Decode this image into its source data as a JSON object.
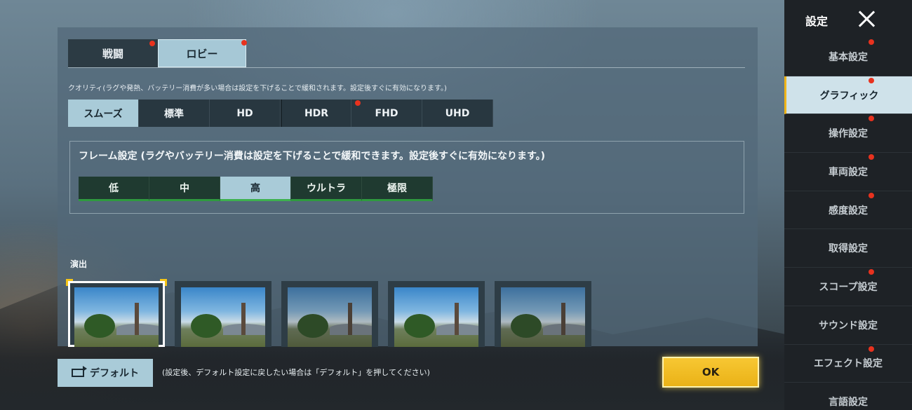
{
  "top_tabs": [
    {
      "label": "戦闘"
    },
    {
      "label": "ロビー"
    }
  ],
  "quality": {
    "note": "クオリティ(ラグや発熱、バッテリー消費が多い場合は設定を下げることで緩和されます。設定後すぐに有効になります。)",
    "options": [
      "スムーズ",
      "標準",
      "HD",
      "HDR",
      "FHD",
      "UHD"
    ],
    "selected": "スムーズ"
  },
  "frame": {
    "title": "フレーム設定 (ラグやバッテリー消費は設定を下げることで緩和できます。設定後すぐに有効になります。)",
    "options": [
      "低",
      "中",
      "高",
      "ウルトラ",
      "極限"
    ],
    "selected": "高"
  },
  "effects": {
    "label": "演出",
    "thumbnails": [
      "effect-style-1",
      "effect-style-2",
      "effect-style-3",
      "effect-style-4",
      "effect-style-5"
    ],
    "selected_index": 0
  },
  "footer": {
    "default_label": "デフォルト",
    "default_note": "(設定後、デフォルト設定に戻したい場合は「デフォルト」を押してください)",
    "ok_label": "OK"
  },
  "sidebar": {
    "title": "設定",
    "items": [
      {
        "label": "基本設定"
      },
      {
        "label": "グラフィック"
      },
      {
        "label": "操作設定"
      },
      {
        "label": "車両設定"
      },
      {
        "label": "感度設定"
      },
      {
        "label": "取得設定"
      },
      {
        "label": "スコープ設定"
      },
      {
        "label": "サウンド設定"
      },
      {
        "label": "エフェクト設定"
      },
      {
        "label": "言語設定"
      }
    ],
    "active_index": 1
  },
  "colors": {
    "accent_selected": "#a9cbd8",
    "notification_dot": "#e8321e",
    "ok_button": "#f2bd24",
    "frame_bar_accent": "#2f9a3f"
  }
}
